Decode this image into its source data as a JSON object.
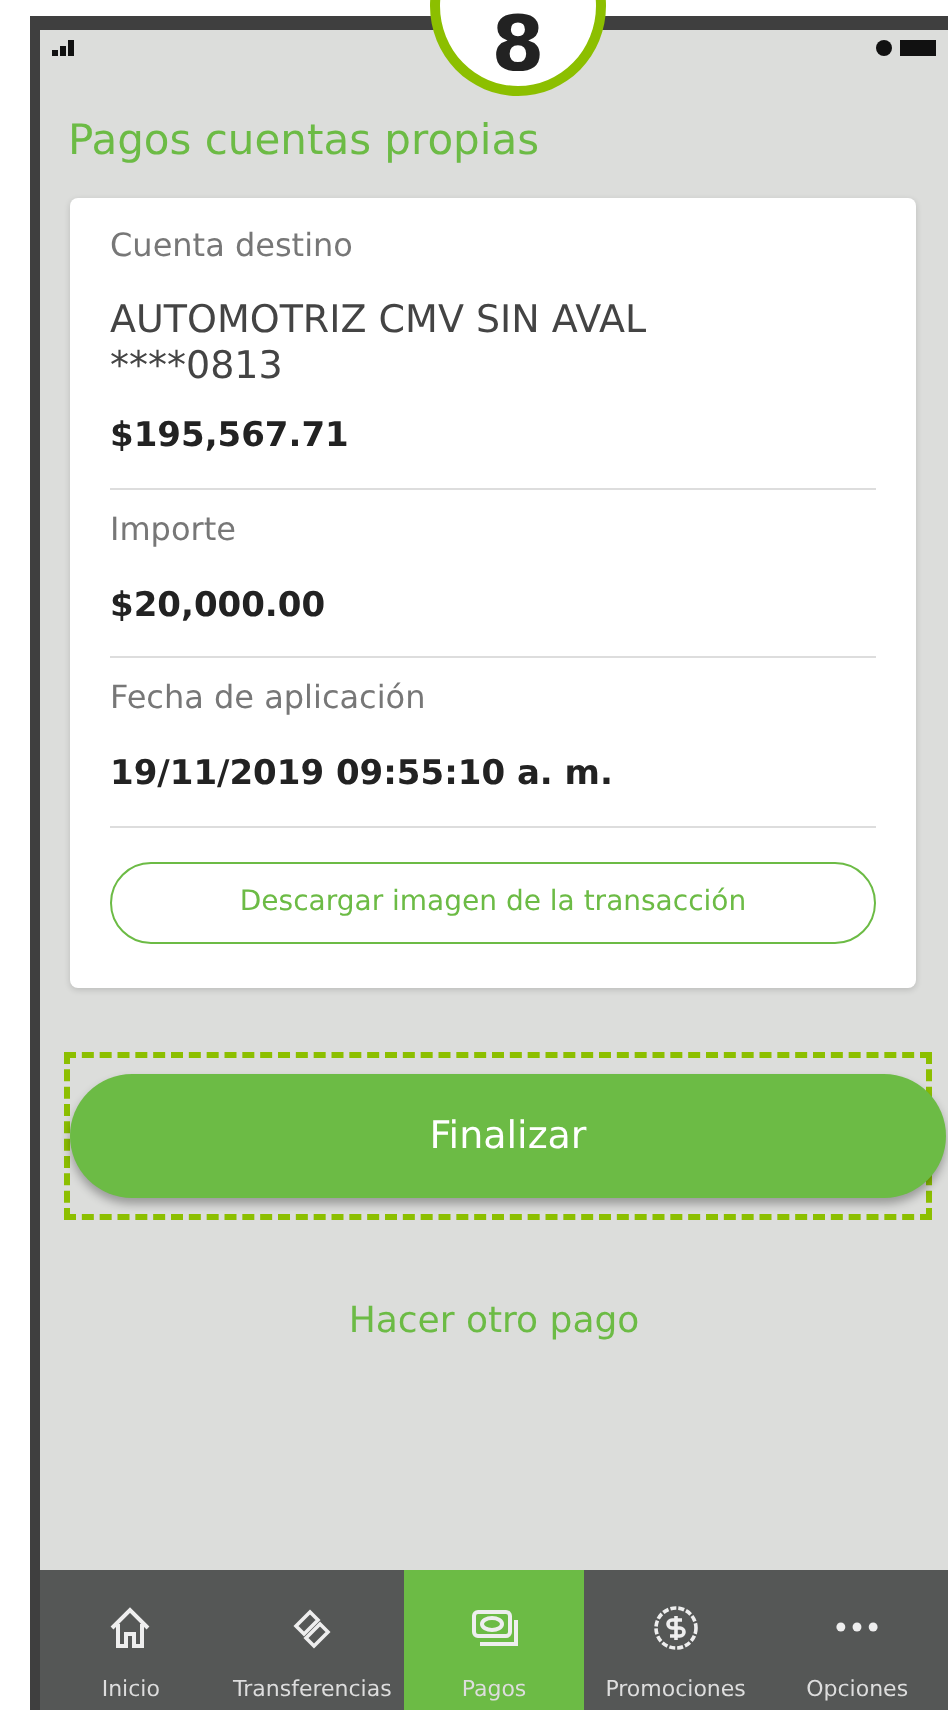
{
  "callout": "8",
  "title": "Pagos cuentas propias",
  "details": [
    {
      "label": "Cuenta destino",
      "values": [
        "AUTOMOTRIZ CMV SIN AVAL",
        "****0813"
      ],
      "amount": "$195,567.71"
    },
    {
      "label": "Importe",
      "amount": "$20,000.00"
    },
    {
      "label": "Fecha de aplicación",
      "amount": "19/11/2019 09:55:10 a. m."
    }
  ],
  "download_button": "Descargar imagen de la transacción",
  "finish_button": {
    "label": "Finalizar",
    "highlighted": true
  },
  "other_payment_link": "Hacer otro pago",
  "tabs": [
    {
      "kind": "home",
      "label": "Inicio",
      "selected": false
    },
    {
      "kind": "transfer",
      "label": "Transferencias",
      "selected": false
    },
    {
      "kind": "payments",
      "label": "Pagos",
      "selected": true
    },
    {
      "kind": "promo",
      "label": "Promociones",
      "selected": false
    },
    {
      "kind": "more",
      "label": "Opciones",
      "selected": false
    }
  ]
}
